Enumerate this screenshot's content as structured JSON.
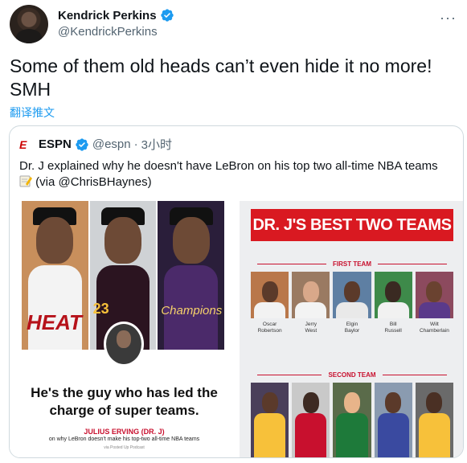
{
  "tweet": {
    "display_name": "Kendrick Perkins",
    "handle": "@KendrickPerkins",
    "text": "Some of them old heads can’t even hide it no more! SMH",
    "translate_label": "翻译推文",
    "more_icon": "more-icon"
  },
  "quoted": {
    "logo_text": "E",
    "display_name": "ESPN",
    "handle": "@espn",
    "separator": "·",
    "time": "3小时",
    "text": "Dr. J explained why he doesn't have LeBron on his top two all-time NBA teams",
    "text_suffix": "(via @ChrisBHaynes)",
    "media": {
      "left": {
        "photo_labels": [
          "HEAT",
          "23",
          "Champions"
        ],
        "quote": "He's the guy who has led the charge of super teams.",
        "attribution": "JULIUS ERVING (DR. J)",
        "attribution_sub": "on why LeBron doesn't make his top-two all-time NBA teams",
        "source": "via Posted Up Podcast"
      },
      "right": {
        "title": "DR. J'S BEST TWO TEAMS",
        "first_team_label": "FIRST TEAM",
        "second_team_label": "SECOND TEAM",
        "first_team": [
          {
            "first": "Oscar",
            "last": "Robertson"
          },
          {
            "first": "Jerry",
            "last": "West"
          },
          {
            "first": "Elgin",
            "last": "Baylor"
          },
          {
            "first": "Bill",
            "last": "Russell"
          },
          {
            "first": "Wilt",
            "last": "Chamberlain"
          }
        ]
      }
    }
  },
  "colors": {
    "accent": "#1d9bf0",
    "espn_red": "#cc0000",
    "title_red": "#d91921"
  }
}
